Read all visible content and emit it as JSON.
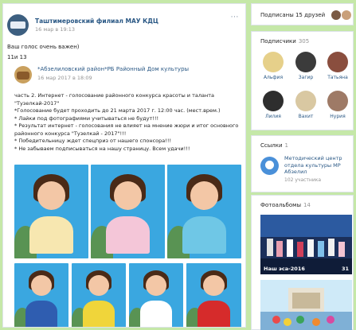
{
  "post": {
    "author": "Таштимеровский филиал МАУ КДЦ",
    "date": "16 мар в 19:13",
    "more_icon": "ellipsis-icon",
    "text_line1": "Ваш голос очень важен)",
    "text_line2": "11и 13"
  },
  "repost": {
    "author": "*Абзелиловский район*РБ Районный Дом культуры",
    "date": "16 мар 2017 в 18:09",
    "body": [
      "часть 2. Интернет - голосование районного конкурса красоты и таланта",
      "\"Тузелкай-2017\"",
      "*Голосование будет проходить до 21 марта 2017 г. 12:00 час. (мест.врем.)",
      "* Лайки под фотографиями учитываться не будут!!!",
      "* Результат интернет - голосования не влияет на мнение жюри и итог основного",
      "районного конкурса \"Тузелкай - 2017\"!!!",
      "* Победительницу ждет спецприз от нашего спонсора!!!",
      "* Не забываем подписываться на нашу страницу. Всем удачи!!!"
    ]
  },
  "friends": {
    "label": "Подписаны 15 друзей"
  },
  "subscribers": {
    "title": "Подписчики",
    "count": "305",
    "members": [
      {
        "name": "Альфия"
      },
      {
        "name": "Загир"
      },
      {
        "name": "Татьяна"
      },
      {
        "name": "Лилия"
      },
      {
        "name": "Вахит"
      },
      {
        "name": "Нурия"
      }
    ]
  },
  "links": {
    "title": "Ссылки",
    "count": "1",
    "item_title": "Методический центр отдела культуры МР Абзелил",
    "item_sub": "102 участника"
  },
  "albums": {
    "title": "Фотоальбомы",
    "count": "14",
    "first_caption": "Наш эса-2016",
    "first_count": "31"
  },
  "colors": {
    "link": "#2a5885",
    "page_bg": "#c5e8a8",
    "photo_bg": "#3aa7e0"
  }
}
